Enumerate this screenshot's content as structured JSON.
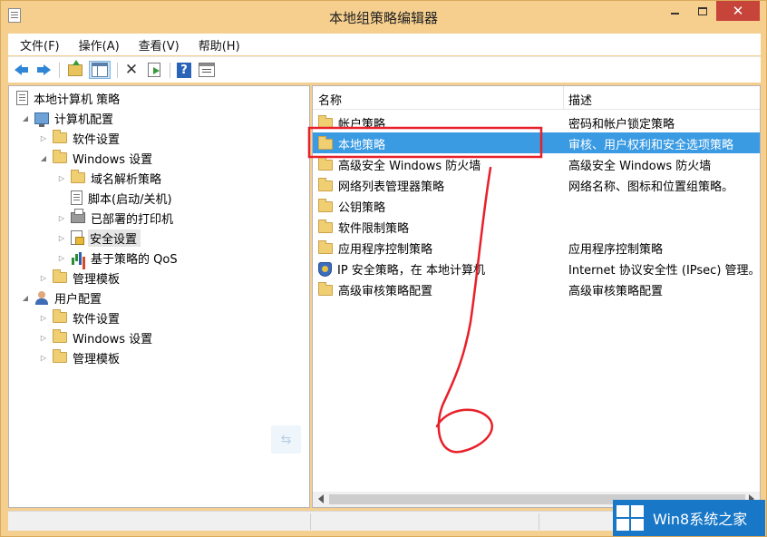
{
  "window": {
    "title": "本地组策略编辑器",
    "close_glyph": "✕"
  },
  "menu": [
    "文件(F)",
    "操作(A)",
    "查看(V)",
    "帮助(H)"
  ],
  "toolbar": {
    "help_glyph": "?",
    "delete_glyph": "✕"
  },
  "tree": {
    "root": "本地计算机 策略",
    "computer_config": "计算机配置",
    "cc_software": "软件设置",
    "cc_windows": "Windows 设置",
    "cc_dns": "域名解析策略",
    "cc_scripts": "脚本(启动/关机)",
    "cc_printers": "已部署的打印机",
    "cc_security": "安全设置",
    "cc_qos": "基于策略的 QoS",
    "cc_admin": "管理模板",
    "user_config": "用户配置",
    "uc_software": "软件设置",
    "uc_windows": "Windows 设置",
    "uc_admin": "管理模板"
  },
  "list": {
    "col_name": "名称",
    "col_desc": "描述",
    "rows": [
      {
        "name": "帐户策略",
        "desc": "密码和帐户锁定策略"
      },
      {
        "name": "本地策略",
        "desc": "审核、用户权利和安全选项策略"
      },
      {
        "name": "高级安全 Windows 防火墙",
        "desc": "高级安全 Windows 防火墙"
      },
      {
        "name": "网络列表管理器策略",
        "desc": "网络名称、图标和位置组策略。"
      },
      {
        "name": "公钥策略",
        "desc": ""
      },
      {
        "name": "软件限制策略",
        "desc": ""
      },
      {
        "name": "应用程序控制策略",
        "desc": "应用程序控制策略"
      },
      {
        "name": "IP 安全策略，在 本地计算机",
        "desc": "Internet 协议安全性 (IPsec) 管理。"
      },
      {
        "name": "高级审核策略配置",
        "desc": "高级审核策略配置"
      }
    ]
  },
  "colors": {
    "selection": "#3a9be3",
    "annotation": "#e8202a",
    "logo_bg": "#1877c7"
  },
  "logo": {
    "text": "Win8系统之家"
  }
}
